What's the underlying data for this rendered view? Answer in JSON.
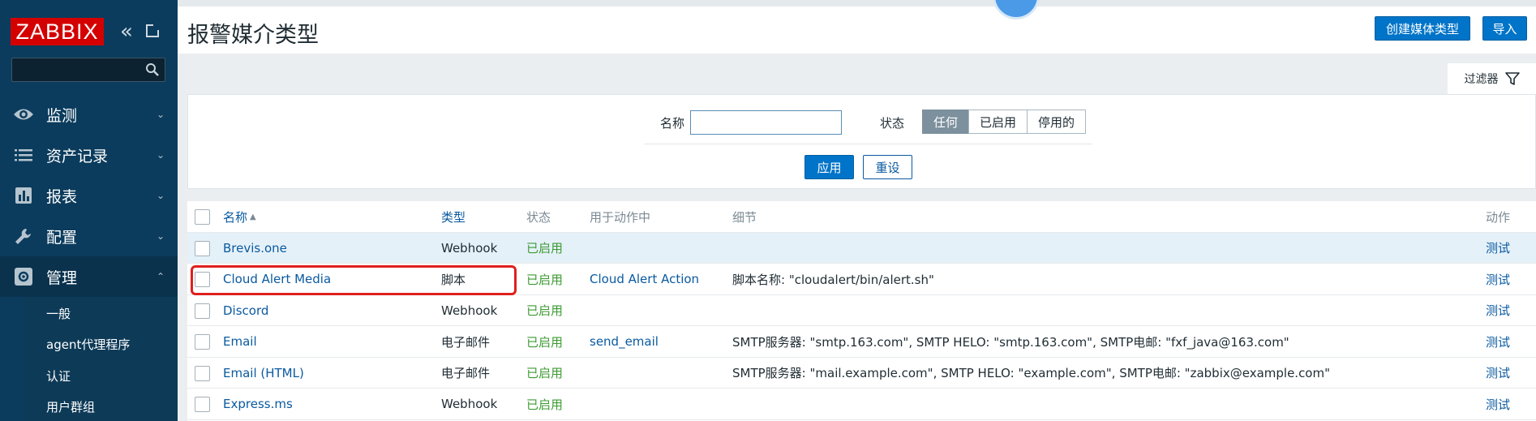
{
  "sidebar": {
    "logo": "ZABBIX",
    "collapse_icon": "double-chevron-left-icon",
    "kiosk_icon": "kiosk-mode-icon",
    "search_placeholder": "",
    "search_icon": "search-icon",
    "nav": [
      {
        "label": "监测",
        "icon": "eye-icon",
        "chevron": "⌄"
      },
      {
        "label": "资产记录",
        "icon": "list-icon",
        "chevron": "⌄"
      },
      {
        "label": "报表",
        "icon": "bar-chart-icon",
        "chevron": "⌄"
      },
      {
        "label": "配置",
        "icon": "wrench-icon",
        "chevron": "⌄"
      },
      {
        "label": "管理",
        "icon": "gear-icon",
        "chevron": "⌃"
      }
    ],
    "submenu": [
      "一般",
      "agent代理程序",
      "认证",
      "用户群组"
    ]
  },
  "header": {
    "title": "报警媒介类型",
    "create_button": "创建媒体类型",
    "import_button": "导入"
  },
  "filter": {
    "tab_label": "过滤器",
    "name_label": "名称",
    "name_value": "",
    "status_label": "状态",
    "status_options": [
      "任何",
      "已启用",
      "停用的"
    ],
    "status_selected": "任何",
    "apply_button": "应用",
    "reset_button": "重设"
  },
  "table": {
    "headers": {
      "name": "名称",
      "sort_arrow": "▲",
      "type": "类型",
      "status": "状态",
      "used_in_actions": "用于动作中",
      "details": "细节",
      "action": "动作"
    },
    "rows": [
      {
        "name": "Brevis.one",
        "type": "Webhook",
        "status": "已启用",
        "used_in_actions": "",
        "details": "",
        "action": "测试"
      },
      {
        "name": "Cloud Alert Media",
        "type": "脚本",
        "status": "已启用",
        "used_in_actions": "Cloud Alert Action",
        "details": "脚本名称: \"cloudalert/bin/alert.sh\"",
        "action": "测试"
      },
      {
        "name": "Discord",
        "type": "Webhook",
        "status": "已启用",
        "used_in_actions": "",
        "details": "",
        "action": "测试"
      },
      {
        "name": "Email",
        "type": "电子邮件",
        "status": "已启用",
        "used_in_actions": "send_email",
        "details": "SMTP服务器: \"smtp.163.com\", SMTP HELO: \"smtp.163.com\", SMTP电邮: \"fxf_java@163.com\"",
        "action": "测试"
      },
      {
        "name": "Email (HTML)",
        "type": "电子邮件",
        "status": "已启用",
        "used_in_actions": "",
        "details": "SMTP服务器: \"mail.example.com\", SMTP HELO: \"example.com\", SMTP电邮: \"zabbix@example.com\"",
        "action": "测试"
      },
      {
        "name": "Express.ms",
        "type": "Webhook",
        "status": "已启用",
        "used_in_actions": "",
        "details": "",
        "action": "测试"
      }
    ]
  },
  "colors": {
    "sidebar_bg": "#0b3c5d",
    "logo_red": "#d40000",
    "link_blue": "#0a5aa0",
    "enabled_green": "#3c9b32",
    "highlight_red": "#e01f1f"
  }
}
